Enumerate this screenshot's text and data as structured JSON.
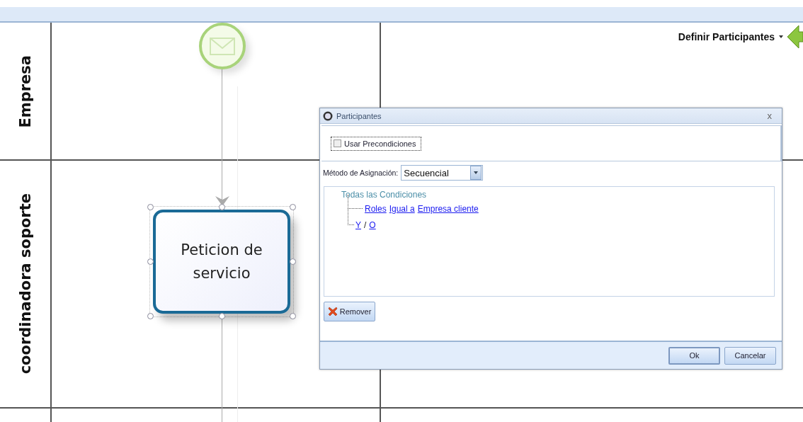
{
  "toolbar": {
    "label": "Definir Participantes"
  },
  "lanes": [
    {
      "name": "Empresa"
    },
    {
      "name": "coordinadora soporte"
    }
  ],
  "task": {
    "label": "Peticion de servicio",
    "selected": true
  },
  "dialog": {
    "title": "Participantes",
    "close": "x",
    "use_preconditions": {
      "label": "Usar Precondiciones",
      "checked": false
    },
    "method": {
      "label": "Método de Asignación:",
      "value": "Secuencial"
    },
    "tree": {
      "label": "Todas las Condiciones",
      "children": [
        {
          "kind": "condition",
          "links": [
            "Roles",
            "Igual a",
            "Empresa cliente"
          ]
        },
        {
          "kind": "connector",
          "links": [
            "Y",
            "O"
          ],
          "separator": "/"
        }
      ]
    },
    "remove_button": "Remover",
    "ok_button": "Ok",
    "cancel_button": "Cancelar"
  }
}
